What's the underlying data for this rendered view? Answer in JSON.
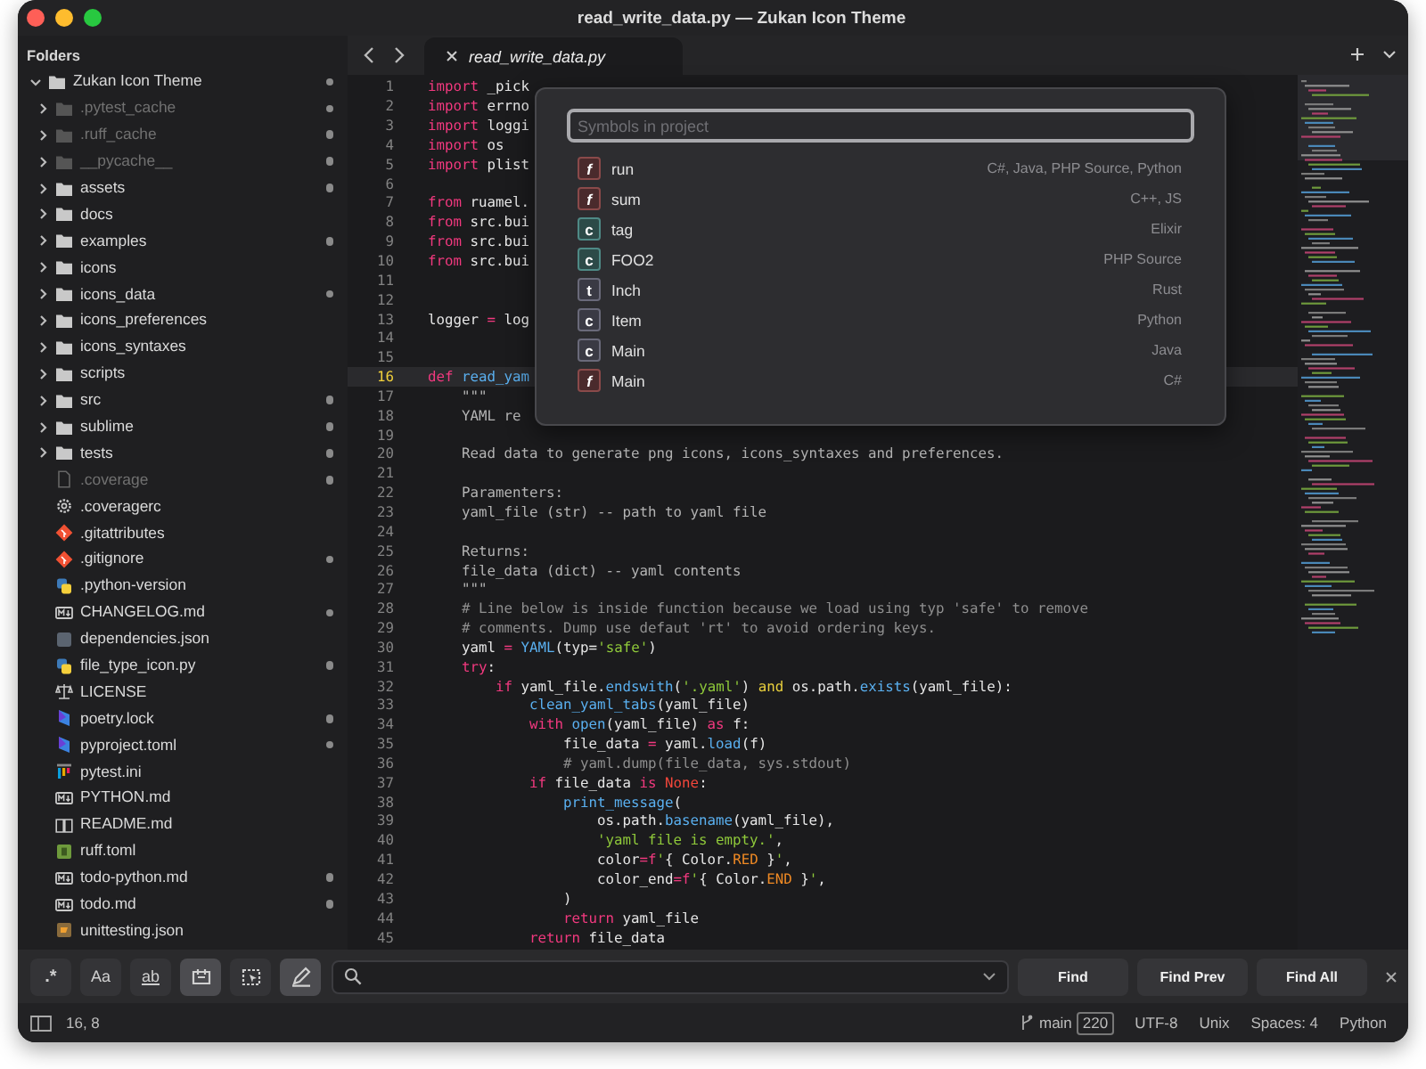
{
  "window": {
    "title": "read_write_data.py — Zukan Icon Theme"
  },
  "sidebar": {
    "heading": "Folders",
    "tree": [
      {
        "name": "Zukan Icon Theme",
        "kind": "folder",
        "expanded": true,
        "dimmed": false,
        "modified": true,
        "children": [
          {
            "name": ".pytest_cache",
            "kind": "folder",
            "expanded": false,
            "dimmed": true,
            "modified": true
          },
          {
            "name": ".ruff_cache",
            "kind": "folder",
            "expanded": false,
            "dimmed": true,
            "modified": true
          },
          {
            "name": "__pycache__",
            "kind": "folder",
            "expanded": false,
            "dimmed": true,
            "modified": true
          },
          {
            "name": "assets",
            "kind": "folder",
            "expanded": false,
            "dimmed": false,
            "modified": true
          },
          {
            "name": "docs",
            "kind": "folder",
            "expanded": false,
            "dimmed": false,
            "modified": false
          },
          {
            "name": "examples",
            "kind": "folder",
            "expanded": false,
            "dimmed": false,
            "modified": true
          },
          {
            "name": "icons",
            "kind": "folder",
            "expanded": false,
            "dimmed": false,
            "modified": false
          },
          {
            "name": "icons_data",
            "kind": "folder",
            "expanded": false,
            "dimmed": false,
            "modified": true
          },
          {
            "name": "icons_preferences",
            "kind": "folder",
            "expanded": false,
            "dimmed": false,
            "modified": false
          },
          {
            "name": "icons_syntaxes",
            "kind": "folder",
            "expanded": false,
            "dimmed": false,
            "modified": false
          },
          {
            "name": "scripts",
            "kind": "folder",
            "expanded": false,
            "dimmed": false,
            "modified": false
          },
          {
            "name": "src",
            "kind": "folder",
            "expanded": false,
            "dimmed": false,
            "modified": true
          },
          {
            "name": "sublime",
            "kind": "folder",
            "expanded": false,
            "dimmed": false,
            "modified": true
          },
          {
            "name": "tests",
            "kind": "folder",
            "expanded": false,
            "dimmed": false,
            "modified": true
          },
          {
            "name": ".coverage",
            "kind": "blank",
            "dimmed": true,
            "modified": true
          },
          {
            "name": ".coveragerc",
            "kind": "settings",
            "dimmed": false,
            "modified": false
          },
          {
            "name": ".gitattributes",
            "kind": "git",
            "dimmed": false,
            "modified": false
          },
          {
            "name": ".gitignore",
            "kind": "git",
            "dimmed": false,
            "modified": true
          },
          {
            "name": ".python-version",
            "kind": "python",
            "dimmed": false,
            "modified": false
          },
          {
            "name": "CHANGELOG.md",
            "kind": "markdown",
            "dimmed": false,
            "modified": true
          },
          {
            "name": "dependencies.json",
            "kind": "json",
            "dimmed": false,
            "modified": false
          },
          {
            "name": "file_type_icon.py",
            "kind": "python",
            "dimmed": false,
            "modified": true
          },
          {
            "name": "LICENSE",
            "kind": "license",
            "dimmed": false,
            "modified": false
          },
          {
            "name": "poetry.lock",
            "kind": "poetry",
            "dimmed": false,
            "modified": true
          },
          {
            "name": "pyproject.toml",
            "kind": "poetry",
            "dimmed": false,
            "modified": true
          },
          {
            "name": "pytest.ini",
            "kind": "pytest",
            "dimmed": false,
            "modified": false
          },
          {
            "name": "PYTHON.md",
            "kind": "markdown",
            "dimmed": false,
            "modified": false
          },
          {
            "name": "README.md",
            "kind": "readme",
            "dimmed": false,
            "modified": false
          },
          {
            "name": "ruff.toml",
            "kind": "ruff",
            "dimmed": false,
            "modified": false
          },
          {
            "name": "todo-python.md",
            "kind": "markdown",
            "dimmed": false,
            "modified": true
          },
          {
            "name": "todo.md",
            "kind": "markdown",
            "dimmed": false,
            "modified": true
          },
          {
            "name": "unittesting.json",
            "kind": "unittest",
            "dimmed": false,
            "modified": false
          }
        ]
      }
    ]
  },
  "tabs": [
    {
      "label": "read_write_data.py",
      "selected": true
    }
  ],
  "editor": {
    "lines": [
      {
        "number": "1",
        "current": false,
        "tokens": [
          {
            "kind": "kw",
            "text": "import"
          },
          {
            "kind": "p",
            "text": " _pick"
          }
        ]
      },
      {
        "number": "2",
        "current": false,
        "tokens": [
          {
            "kind": "kw",
            "text": "import"
          },
          {
            "kind": "p",
            "text": " errno"
          }
        ]
      },
      {
        "number": "3",
        "current": false,
        "tokens": [
          {
            "kind": "kw",
            "text": "import"
          },
          {
            "kind": "p",
            "text": " loggi"
          }
        ]
      },
      {
        "number": "4",
        "current": false,
        "tokens": [
          {
            "kind": "kw",
            "text": "import"
          },
          {
            "kind": "p",
            "text": " os"
          }
        ]
      },
      {
        "number": "5",
        "current": false,
        "tokens": [
          {
            "kind": "kw",
            "text": "import"
          },
          {
            "kind": "p",
            "text": " plist"
          }
        ]
      },
      {
        "number": "6",
        "current": false
      },
      {
        "number": "7",
        "current": false,
        "tokens": [
          {
            "kind": "kw",
            "text": "from"
          },
          {
            "kind": "p",
            "text": " ruamel."
          }
        ]
      },
      {
        "number": "8",
        "current": false,
        "tokens": [
          {
            "kind": "kw",
            "text": "from"
          },
          {
            "kind": "p",
            "text": " src.bui"
          }
        ]
      },
      {
        "number": "9",
        "current": false,
        "tokens": [
          {
            "kind": "kw",
            "text": "from"
          },
          {
            "kind": "p",
            "text": " src.bui"
          }
        ]
      },
      {
        "number": "10",
        "current": false,
        "tokens": [
          {
            "kind": "kw",
            "text": "from"
          },
          {
            "kind": "p",
            "text": " src.bui"
          }
        ]
      },
      {
        "number": "11",
        "current": false
      },
      {
        "number": "12",
        "current": false
      },
      {
        "number": "13",
        "current": false,
        "tokens": [
          {
            "kind": "p",
            "text": "logger "
          },
          {
            "kind": "kw",
            "text": "="
          },
          {
            "kind": "p",
            "text": " log"
          }
        ]
      },
      {
        "number": "14",
        "current": false
      },
      {
        "number": "15",
        "current": false
      },
      {
        "number": "16",
        "current": true,
        "tokens": [
          {
            "kind": "kw",
            "text": "def"
          },
          {
            "kind": "fn",
            "text": " read_yam"
          }
        ]
      },
      {
        "number": "17",
        "current": false,
        "tokens": [
          {
            "kind": "doc",
            "text": "    \"\"\""
          }
        ]
      },
      {
        "number": "18",
        "current": false,
        "tokens": [
          {
            "kind": "doc",
            "text": "    YAML re"
          }
        ]
      },
      {
        "number": "19",
        "current": false
      },
      {
        "number": "20",
        "current": false,
        "tokens": [
          {
            "kind": "doc",
            "text": "    Read data to generate png icons, icons_syntaxes and preferences."
          }
        ]
      },
      {
        "number": "21",
        "current": false
      },
      {
        "number": "22",
        "current": false,
        "tokens": [
          {
            "kind": "doc",
            "text": "    Paramenters:"
          }
        ]
      },
      {
        "number": "23",
        "current": false,
        "tokens": [
          {
            "kind": "doc",
            "text": "    yaml_file (str) -- path to yaml file"
          }
        ]
      },
      {
        "number": "24",
        "current": false
      },
      {
        "number": "25",
        "current": false,
        "tokens": [
          {
            "kind": "doc",
            "text": "    Returns:"
          }
        ]
      },
      {
        "number": "26",
        "current": false,
        "tokens": [
          {
            "kind": "doc",
            "text": "    file_data (dict) -- yaml contents"
          }
        ]
      },
      {
        "number": "27",
        "current": false,
        "tokens": [
          {
            "kind": "doc",
            "text": "    \"\"\""
          }
        ]
      },
      {
        "number": "28",
        "current": false,
        "tokens": [
          {
            "kind": "com",
            "text": "    # Line below is inside function because we load using typ 'safe' to remove"
          }
        ]
      },
      {
        "number": "29",
        "current": false,
        "tokens": [
          {
            "kind": "com",
            "text": "    # comments. Dump use defaut 'rt' to avoid ordering keys."
          }
        ]
      },
      {
        "number": "30",
        "current": false,
        "tokens": [
          {
            "kind": "p",
            "text": "    yaml "
          },
          {
            "kind": "kw",
            "text": "="
          },
          {
            "kind": "fn",
            "text": " YAML"
          },
          {
            "kind": "p",
            "text": "(typ="
          },
          {
            "kind": "str",
            "text": "'safe'"
          },
          {
            "kind": "p",
            "text": ")"
          }
        ]
      },
      {
        "number": "31",
        "current": false,
        "tokens": [
          {
            "kind": "kw",
            "text": "    try"
          },
          {
            "kind": "p",
            "text": ":"
          }
        ]
      },
      {
        "number": "32",
        "current": false,
        "tokens": [
          {
            "kind": "kw",
            "text": "        if"
          },
          {
            "kind": "p",
            "text": " yaml_file."
          },
          {
            "kind": "fn",
            "text": "endswith"
          },
          {
            "kind": "p",
            "text": "("
          },
          {
            "kind": "str",
            "text": "'.yaml'"
          },
          {
            "kind": "p",
            "text": ") "
          },
          {
            "kind": "op",
            "text": "and"
          },
          {
            "kind": "p",
            "text": " os.path."
          },
          {
            "kind": "fn",
            "text": "exists"
          },
          {
            "kind": "p",
            "text": "(yaml_file):"
          }
        ]
      },
      {
        "number": "33",
        "current": false,
        "tokens": [
          {
            "kind": "fn",
            "text": "            clean_yaml_tabs"
          },
          {
            "kind": "p",
            "text": "(yaml_file)"
          }
        ]
      },
      {
        "number": "34",
        "current": false,
        "tokens": [
          {
            "kind": "kw",
            "text": "            with"
          },
          {
            "kind": "fn",
            "text": " open"
          },
          {
            "kind": "p",
            "text": "(yaml_file) "
          },
          {
            "kind": "kw",
            "text": "as"
          },
          {
            "kind": "p",
            "text": " f:"
          }
        ]
      },
      {
        "number": "35",
        "current": false,
        "tokens": [
          {
            "kind": "p",
            "text": "                file_data "
          },
          {
            "kind": "kw",
            "text": "="
          },
          {
            "kind": "p",
            "text": " yaml."
          },
          {
            "kind": "fn",
            "text": "load"
          },
          {
            "kind": "p",
            "text": "(f)"
          }
        ]
      },
      {
        "number": "36",
        "current": false,
        "tokens": [
          {
            "kind": "com",
            "text": "                # yaml.dump(file_data, sys.stdout)"
          }
        ]
      },
      {
        "number": "37",
        "current": false,
        "tokens": [
          {
            "kind": "kw",
            "text": "            if"
          },
          {
            "kind": "p",
            "text": " file_data "
          },
          {
            "kind": "kw",
            "text": "is"
          },
          {
            "kind": "none",
            "text": " None"
          },
          {
            "kind": "p",
            "text": ":"
          }
        ]
      },
      {
        "number": "38",
        "current": false,
        "tokens": [
          {
            "kind": "fn",
            "text": "                print_message"
          },
          {
            "kind": "p",
            "text": "("
          }
        ]
      },
      {
        "number": "39",
        "current": false,
        "tokens": [
          {
            "kind": "p",
            "text": "                    os.path."
          },
          {
            "kind": "fn",
            "text": "basename"
          },
          {
            "kind": "p",
            "text": "(yaml_file),"
          }
        ]
      },
      {
        "number": "40",
        "current": false,
        "tokens": [
          {
            "kind": "str",
            "text": "                    'yaml file is empty.'"
          },
          {
            "kind": "p",
            "text": ","
          }
        ]
      },
      {
        "number": "41",
        "current": false,
        "tokens": [
          {
            "kind": "p",
            "text": "                    color"
          },
          {
            "kind": "kw",
            "text": "=f"
          },
          {
            "kind": "str",
            "text": "'"
          },
          {
            "kind": "p",
            "text": "{ Color."
          },
          {
            "kind": "const",
            "text": "RED"
          },
          {
            "kind": "p",
            "text": " }"
          },
          {
            "kind": "str",
            "text": "'"
          },
          {
            "kind": "p",
            "text": ","
          }
        ]
      },
      {
        "number": "42",
        "current": false,
        "tokens": [
          {
            "kind": "p",
            "text": "                    color_end"
          },
          {
            "kind": "kw",
            "text": "=f"
          },
          {
            "kind": "str",
            "text": "'"
          },
          {
            "kind": "p",
            "text": "{ Color."
          },
          {
            "kind": "const",
            "text": "END"
          },
          {
            "kind": "p",
            "text": " }"
          },
          {
            "kind": "str",
            "text": "'"
          },
          {
            "kind": "p",
            "text": ","
          }
        ]
      },
      {
        "number": "43",
        "current": false,
        "tokens": [
          {
            "kind": "p",
            "text": "                )"
          }
        ]
      },
      {
        "number": "44",
        "current": false,
        "tokens": [
          {
            "kind": "kw",
            "text": "                return"
          },
          {
            "kind": "p",
            "text": " yaml_file"
          }
        ]
      },
      {
        "number": "45",
        "current": false,
        "tokens": [
          {
            "kind": "kw",
            "text": "            return"
          },
          {
            "kind": "p",
            "text": " file_data"
          }
        ]
      }
    ]
  },
  "symbol_palette": {
    "placeholder": "Symbols in project",
    "items": [
      {
        "kind": "function",
        "letter": "f",
        "name": "run",
        "languages": "C#, Java, PHP Source, Python"
      },
      {
        "kind": "function",
        "letter": "f",
        "name": "sum",
        "languages": "C++, JS"
      },
      {
        "kind": "constant",
        "letter": "c",
        "name": "tag",
        "languages": "Elixir"
      },
      {
        "kind": "constant",
        "letter": "c",
        "name": "FOO2",
        "languages": "PHP Source"
      },
      {
        "kind": "type",
        "letter": "t",
        "name": "Inch",
        "languages": "Rust"
      },
      {
        "kind": "class",
        "letter": "c",
        "name": "Item",
        "languages": "Python"
      },
      {
        "kind": "class",
        "letter": "c",
        "name": "Main",
        "languages": "Java"
      },
      {
        "kind": "function",
        "letter": "f",
        "name": "Main",
        "languages": "C#"
      }
    ]
  },
  "find_bar": {
    "toggles": [
      {
        "kind": "regex",
        "label": ".*",
        "selected": false
      },
      {
        "kind": "case",
        "label": "Aa",
        "selected": false
      },
      {
        "kind": "word",
        "label": "ab",
        "selected": false
      },
      {
        "kind": "wrap",
        "selected": true
      },
      {
        "kind": "in-selection",
        "selected": false
      },
      {
        "kind": "highlight",
        "selected": true
      }
    ],
    "buttons": [
      "Find",
      "Find Prev",
      "Find All"
    ]
  },
  "status_bar": {
    "position": "16, 8",
    "branch": "main",
    "changes": "220",
    "encoding": "UTF-8",
    "line_endings": "Unix",
    "indentation": "Spaces: 4",
    "syntax": "Python"
  }
}
